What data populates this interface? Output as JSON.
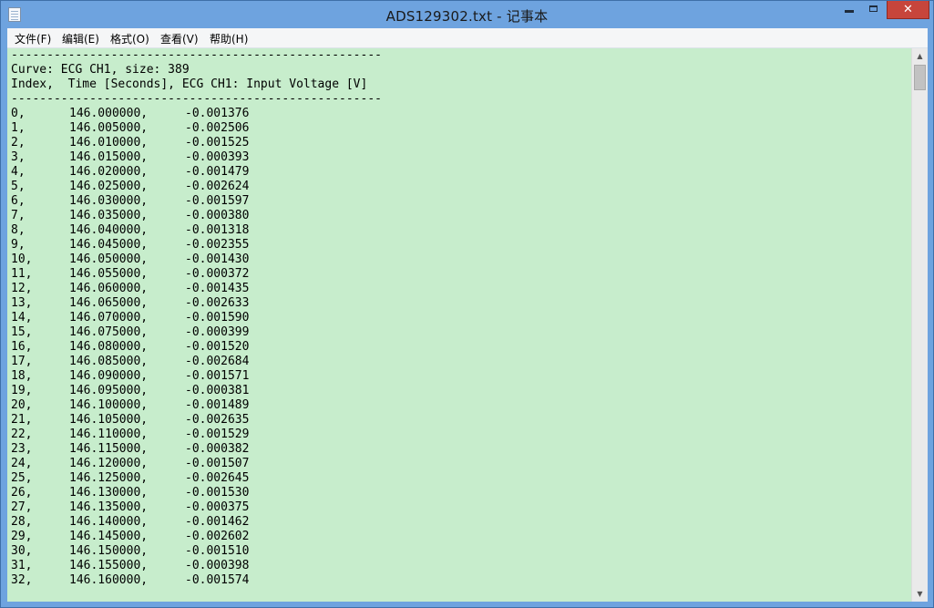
{
  "window": {
    "title": "ADS129302.txt - 记事本",
    "icon": "notepad-icon",
    "buttons": {
      "minimize": "minimize-icon",
      "maximize": "maximize-icon",
      "close": "✕"
    }
  },
  "menu": [
    "文件(F)",
    "编辑(E)",
    "格式(O)",
    "查看(V)",
    "帮助(H)"
  ],
  "editor": {
    "background_color": "#c7edcc",
    "separator": "----------------------------------------------------",
    "header_lines": [
      "Curve: ECG CH1, size: 389",
      "Index,  Time [Seconds], ECG CH1: Input Voltage [V]"
    ],
    "rows": [
      [
        "0,",
        "146.000000,",
        "-0.001376"
      ],
      [
        "1,",
        "146.005000,",
        "-0.002506"
      ],
      [
        "2,",
        "146.010000,",
        "-0.001525"
      ],
      [
        "3,",
        "146.015000,",
        "-0.000393"
      ],
      [
        "4,",
        "146.020000,",
        "-0.001479"
      ],
      [
        "5,",
        "146.025000,",
        "-0.002624"
      ],
      [
        "6,",
        "146.030000,",
        "-0.001597"
      ],
      [
        "7,",
        "146.035000,",
        "-0.000380"
      ],
      [
        "8,",
        "146.040000,",
        "-0.001318"
      ],
      [
        "9,",
        "146.045000,",
        "-0.002355"
      ],
      [
        "10,",
        "146.050000,",
        "-0.001430"
      ],
      [
        "11,",
        "146.055000,",
        "-0.000372"
      ],
      [
        "12,",
        "146.060000,",
        "-0.001435"
      ],
      [
        "13,",
        "146.065000,",
        "-0.002633"
      ],
      [
        "14,",
        "146.070000,",
        "-0.001590"
      ],
      [
        "15,",
        "146.075000,",
        "-0.000399"
      ],
      [
        "16,",
        "146.080000,",
        "-0.001520"
      ],
      [
        "17,",
        "146.085000,",
        "-0.002684"
      ],
      [
        "18,",
        "146.090000,",
        "-0.001571"
      ],
      [
        "19,",
        "146.095000,",
        "-0.000381"
      ],
      [
        "20,",
        "146.100000,",
        "-0.001489"
      ],
      [
        "21,",
        "146.105000,",
        "-0.002635"
      ],
      [
        "22,",
        "146.110000,",
        "-0.001529"
      ],
      [
        "23,",
        "146.115000,",
        "-0.000382"
      ],
      [
        "24,",
        "146.120000,",
        "-0.001507"
      ],
      [
        "25,",
        "146.125000,",
        "-0.002645"
      ],
      [
        "26,",
        "146.130000,",
        "-0.001530"
      ],
      [
        "27,",
        "146.135000,",
        "-0.000375"
      ],
      [
        "28,",
        "146.140000,",
        "-0.001462"
      ],
      [
        "29,",
        "146.145000,",
        "-0.002602"
      ],
      [
        "30,",
        "146.150000,",
        "-0.001510"
      ],
      [
        "31,",
        "146.155000,",
        "-0.000398"
      ],
      [
        "32,",
        "146.160000,",
        "-0.001574"
      ]
    ]
  }
}
